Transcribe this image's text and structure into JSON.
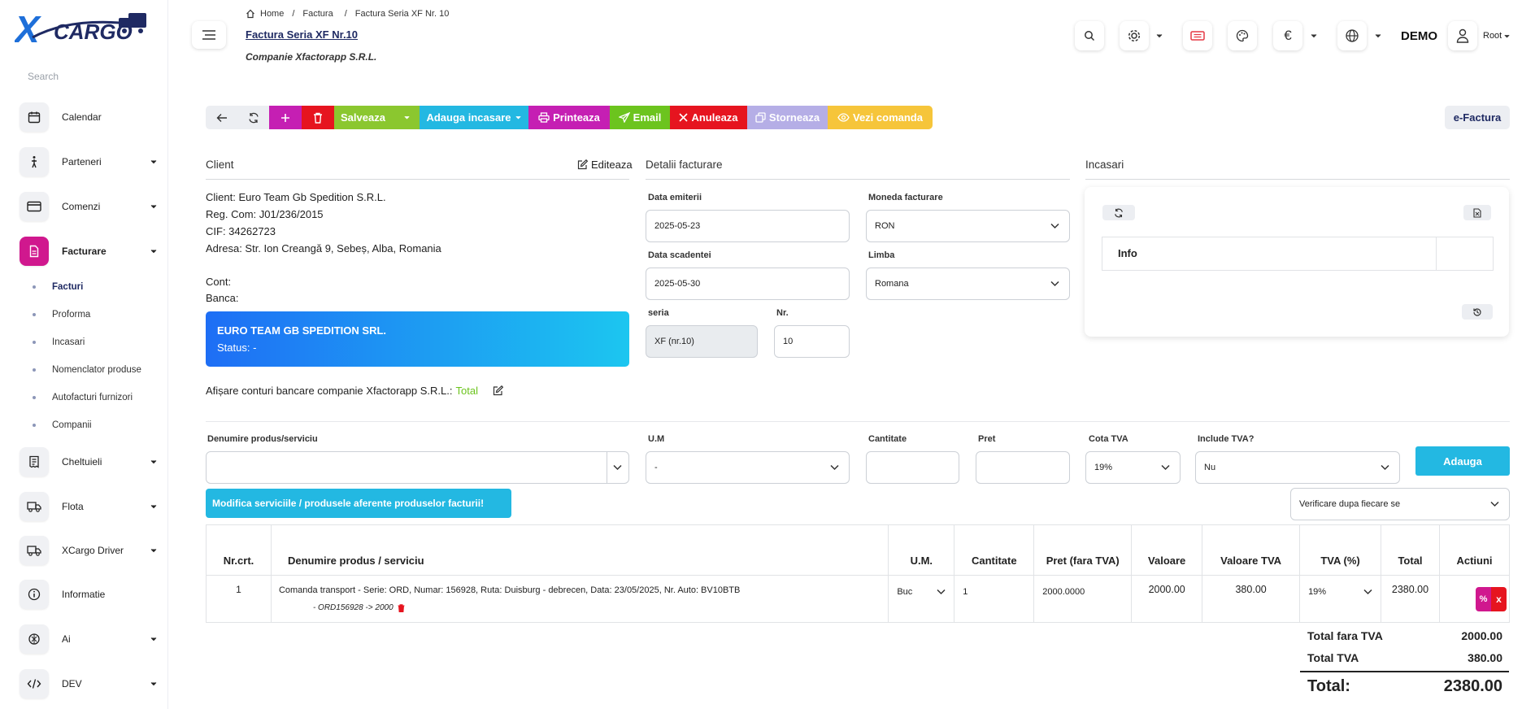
{
  "brand": {
    "logo_text": "CARGO",
    "logo_x": "X"
  },
  "sidebar": {
    "search_placeholder": "Search",
    "items": [
      {
        "label": "Calendar"
      },
      {
        "label": "Parteneri"
      },
      {
        "label": "Comenzi"
      },
      {
        "label": "Facturare"
      },
      {
        "label": "Cheltuieli"
      },
      {
        "label": "Flota"
      },
      {
        "label": "XCargo Driver"
      },
      {
        "label": "Informatie"
      },
      {
        "label": "Ai"
      },
      {
        "label": "DEV"
      }
    ],
    "sub_items": [
      {
        "label": "Facturi"
      },
      {
        "label": "Proforma"
      },
      {
        "label": "Incasari"
      },
      {
        "label": "Nomenclator produse"
      },
      {
        "label": "Autofacturi furnizori"
      },
      {
        "label": "Companii"
      }
    ]
  },
  "header": {
    "breadcrumb": [
      "Home",
      "Factura",
      "Factura Seria XF Nr. 10"
    ],
    "title": "Factura Seria XF Nr.10",
    "subtitle": "Companie Xfactorapp S.R.L.",
    "currency_symbol": "€",
    "account": "DEMO",
    "user": "Root"
  },
  "toolbar": {
    "save": "Salveaza",
    "add_payment": "Adauga incasare",
    "print": "Printeaza",
    "email": "Email",
    "cancel": "Anuleaza",
    "reverse": "Storneaza",
    "view_order": "Vezi comanda",
    "efactura": "e-Factura"
  },
  "client": {
    "header": "Client",
    "edit": "Editeaza",
    "lines": [
      "Client: Euro Team Gb Spedition S.R.L.",
      "Reg. Com: J01/236/2015",
      "CIF: 34262723",
      "Adresa: Str. Ion Creangă 9, Sebeș, Alba, Romania"
    ],
    "cont": "Cont:",
    "banca": "Banca:",
    "banner_name": "EURO TEAM GB SPEDITION SRL.",
    "banner_status": "Status: -",
    "bank_accounts_label": "Afișare conturi bancare companie Xfactorapp S.R.L.:",
    "bank_accounts_value": "Total"
  },
  "billing": {
    "header": "Detalii facturare",
    "issue_date_label": "Data emiterii",
    "issue_date": "2025-05-23",
    "currency_label": "Moneda facturare",
    "currency": "RON",
    "due_date_label": "Data scadentei",
    "due_date": "2025-05-30",
    "language_label": "Limba",
    "language": "Romana",
    "series_label": "seria",
    "series": "XF (nr.10)",
    "number_label": "Nr.",
    "number": "10"
  },
  "payments": {
    "header": "Incasari",
    "info": "Info"
  },
  "add_product": {
    "name_label": "Denumire produs/serviciu",
    "um_label": "U.M",
    "um_value": "-",
    "qty_label": "Cantitate",
    "price_label": "Pret",
    "vat_label": "Cota TVA",
    "vat_value": "19%",
    "incl_vat_label": "Include TVA?",
    "incl_vat_value": "Nu",
    "add_button": "Adauga",
    "modify_button": "Modifica serviciile / produsele aferente produselor facturii!",
    "verify_select": "Verificare dupa fiecare se"
  },
  "table": {
    "headers": [
      "Nr.crt.",
      "Denumire produs / serviciu",
      "U.M.",
      "Cantitate",
      "Pret (fara TVA)",
      "Valoare",
      "Valoare TVA",
      "TVA (%)",
      "Total",
      "Actiuni"
    ],
    "rows": [
      {
        "nr": "1",
        "name": "Comanda transport - Serie: ORD, Numar: 156928, Ruta: Duisburg  - debrecen, Data: 23/05/2025, Nr. Auto: BV10BTB",
        "sub": "- ORD156928 -> 2000",
        "um": "Buc",
        "qty": "1",
        "price": "2000.0000",
        "value": "2000.00",
        "vat_value": "380.00",
        "vat": "19%",
        "total": "2380.00"
      }
    ]
  },
  "totals": {
    "net_label": "Total fara TVA",
    "net": "2000.00",
    "vat_label": "Total TVA",
    "vat": "380.00",
    "total_label": "Total:",
    "total": "2380.00"
  },
  "colors": {
    "accent_magenta": "#d0188e",
    "save_green": "#8bc72f",
    "payment_cyan": "#23b8e2",
    "print_magenta": "#c51fb3",
    "email_green": "#6cc41e",
    "cancel_red": "#e6141f",
    "reverse_lavender": "#b5aee6",
    "order_yellow": "#f6c53a",
    "navy": "#1f2a63",
    "banner_start": "#1e6ef5",
    "banner_end": "#1cc6f0"
  }
}
